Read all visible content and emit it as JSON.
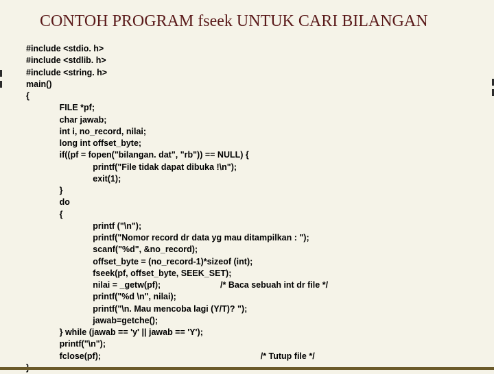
{
  "title": "CONTOH PROGRAM fseek UNTUK CARI BILANGAN",
  "code": {
    "l1": "#include <stdio. h>",
    "l2": "#include <stdlib. h>",
    "l3": "#include <string. h>",
    "l4": "main()",
    "l5": "{",
    "l6": "FILE *pf;",
    "l7": "char jawab;",
    "l8": "int i, no_record, nilai;",
    "l9": "long int offset_byte;",
    "l10": "if((pf = fopen(\"bilangan. dat\", \"rb\")) == NULL) {",
    "l11": "printf(\"File tidak dapat dibuka !\\n\");",
    "l12": "exit(1);",
    "l13": "}",
    "l14": "do",
    "l15": "{",
    "l16": "printf (\"\\n\");",
    "l17": "printf(\"Nomor record dr data yg mau ditampilkan : \");",
    "l18": "scanf(\"%d\", &no_record);",
    "l19": "offset_byte = (no_record-1)*sizeof (int);",
    "l20": "fseek(pf, offset_byte, SEEK_SET);",
    "l21a": "nilai = _getw(pf);",
    "l21b": "/* Baca sebuah int dr file */",
    "l22": "printf(\"%d \\n\", nilai);",
    "l23": "printf(\"\\n. Mau mencoba lagi (Y/T)? \");",
    "l24": "jawab=getche();",
    "l25": "} while (jawab == 'y' || jawab == 'Y');",
    "l26": "printf(\"\\n\");",
    "l27a": "fclose(pf);",
    "l27b": "/* Tutup file */",
    "l28": "}"
  }
}
